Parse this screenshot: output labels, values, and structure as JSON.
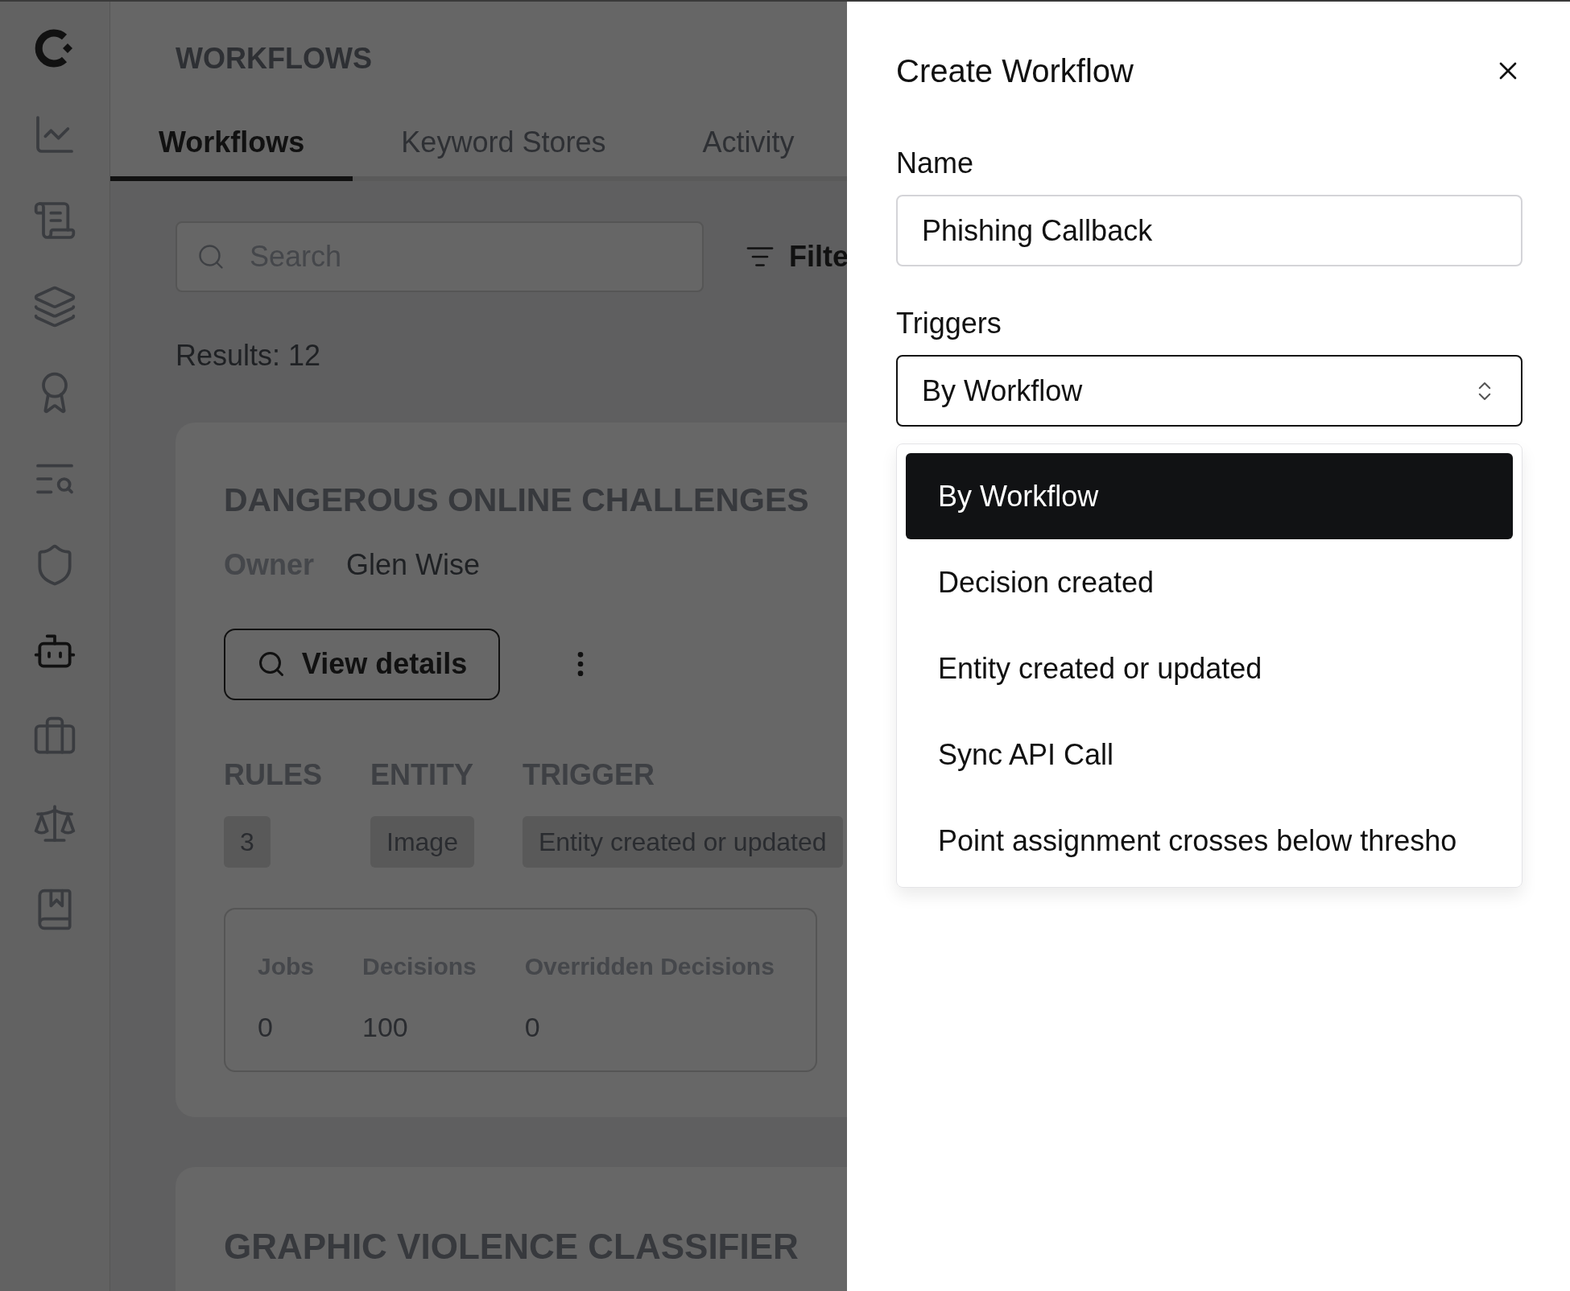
{
  "sidebar": {
    "items": [
      {
        "selected": false
      },
      {
        "selected": false
      },
      {
        "selected": false
      },
      {
        "selected": false
      },
      {
        "selected": false
      },
      {
        "selected": false
      },
      {
        "selected": true
      },
      {
        "selected": false
      },
      {
        "selected": false
      },
      {
        "selected": false
      }
    ]
  },
  "page": {
    "title": "WORKFLOWS"
  },
  "tabs": [
    {
      "label": "Workflows",
      "selected": true
    },
    {
      "label": "Keyword Stores",
      "selected": false
    },
    {
      "label": "Activity",
      "selected": false
    }
  ],
  "search": {
    "placeholder": "Search"
  },
  "filter": {
    "label": "Filte"
  },
  "results": "Results: 12",
  "cards": [
    {
      "title": "DANGEROUS ONLINE CHALLENGES",
      "owner_label": "Owner",
      "owner": "Glen Wise",
      "button": "View details",
      "fields": [
        {
          "label": "RULES",
          "value": "3"
        },
        {
          "label": "ENTITY",
          "value": "Image"
        },
        {
          "label": "TRIGGER",
          "value": "Entity created or updated"
        }
      ],
      "stats": [
        {
          "label": "Jobs",
          "value": "0"
        },
        {
          "label": "Decisions",
          "value": "100"
        },
        {
          "label": "Overridden Decisions",
          "value": "0"
        }
      ]
    },
    {
      "title": "GRAPHIC VIOLENCE CLASSIFIER"
    }
  ],
  "panel": {
    "title": "Create Workflow",
    "name_label": "Name",
    "name_value": "Phishing Callback",
    "triggers_label": "Triggers",
    "trigger_value": "By Workflow",
    "options": [
      {
        "label": "By Workflow",
        "selected": true
      },
      {
        "label": "Decision created",
        "selected": false
      },
      {
        "label": "Entity created or updated",
        "selected": false
      },
      {
        "label": "Sync API Call",
        "selected": false
      },
      {
        "label": "Point assignment crosses below thresho",
        "selected": false
      }
    ]
  }
}
